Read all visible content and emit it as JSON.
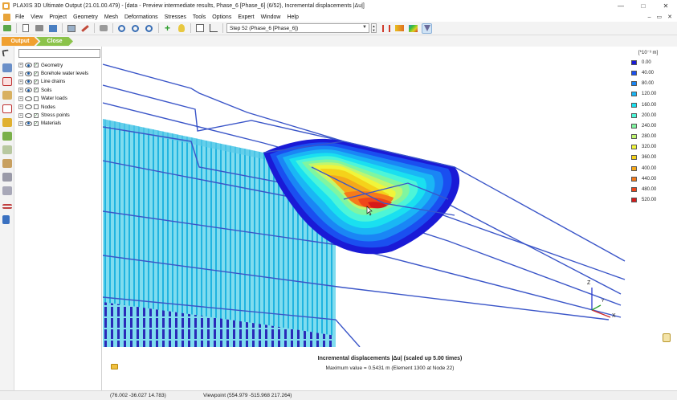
{
  "window": {
    "title": "PLAXIS 3D Ultimate Output (21.01.00.479) - [data - Preview intermediate results, Phase_6 [Phase_6] (6/52), Incremental displacements |Δu|]",
    "minimize": "—",
    "maximize": "□",
    "close": "✕"
  },
  "menu": {
    "items": [
      "File",
      "View",
      "Project",
      "Geometry",
      "Mesh",
      "Deformations",
      "Stresses",
      "Tools",
      "Options",
      "Expert",
      "Window",
      "Help"
    ],
    "mdi_min": "–",
    "mdi_restore": "▭",
    "mdi_close": "✕"
  },
  "toolbar": {
    "step_value": "Step 52 (Phase_6 [Phase_6])",
    "dropdown_glyph": "▼",
    "spin_up": "▲",
    "spin_down": "▼"
  },
  "modes": {
    "output": "Output",
    "close": "Close"
  },
  "tree": {
    "expander_glyph": "+",
    "check_glyph": "✓",
    "items": [
      {
        "label": "Geometry",
        "visible": true,
        "checked": true
      },
      {
        "label": "Borehole water levels",
        "visible": true,
        "checked": true
      },
      {
        "label": "Line drains",
        "visible": true,
        "checked": true
      },
      {
        "label": "Soils",
        "visible": true,
        "checked": true
      },
      {
        "label": "Water loads",
        "visible": false,
        "checked": false
      },
      {
        "label": "Nodes",
        "visible": false,
        "checked": false
      },
      {
        "label": "Stress points",
        "visible": false,
        "checked": true
      },
      {
        "label": "Materials",
        "visible": true,
        "checked": true
      }
    ]
  },
  "legend": {
    "unit": "[*10⁻³ m]",
    "entries": [
      {
        "label": "0.00",
        "color": "#1a1ad6"
      },
      {
        "label": "40.00",
        "color": "#1a4ff0"
      },
      {
        "label": "80.00",
        "color": "#1a86f5"
      },
      {
        "label": "120.00",
        "color": "#1ab6f5"
      },
      {
        "label": "160.00",
        "color": "#1ae0f0"
      },
      {
        "label": "200.00",
        "color": "#4df5d8"
      },
      {
        "label": "240.00",
        "color": "#80f5a0"
      },
      {
        "label": "280.00",
        "color": "#bff570"
      },
      {
        "label": "320.00",
        "color": "#f0f53a"
      },
      {
        "label": "360.00",
        "color": "#f5d21a"
      },
      {
        "label": "400.00",
        "color": "#f5a81a"
      },
      {
        "label": "440.00",
        "color": "#f57a1a"
      },
      {
        "label": "480.00",
        "color": "#f0461a"
      },
      {
        "label": "520.00",
        "color": "#d61a1a"
      }
    ]
  },
  "axes": {
    "z": "Z",
    "y": "Y",
    "x": "X"
  },
  "info": {
    "title": "Incremental displacements |Δu| (scaled up 5.00 times)",
    "max": "Maximum value = 0.5431 m (Element 1300 at Node 22)"
  },
  "status": {
    "coordinates": "(76.002 -36.027 14.783)",
    "viewpoint": "Viewpoint (554.979 -515.968 217.264)"
  }
}
